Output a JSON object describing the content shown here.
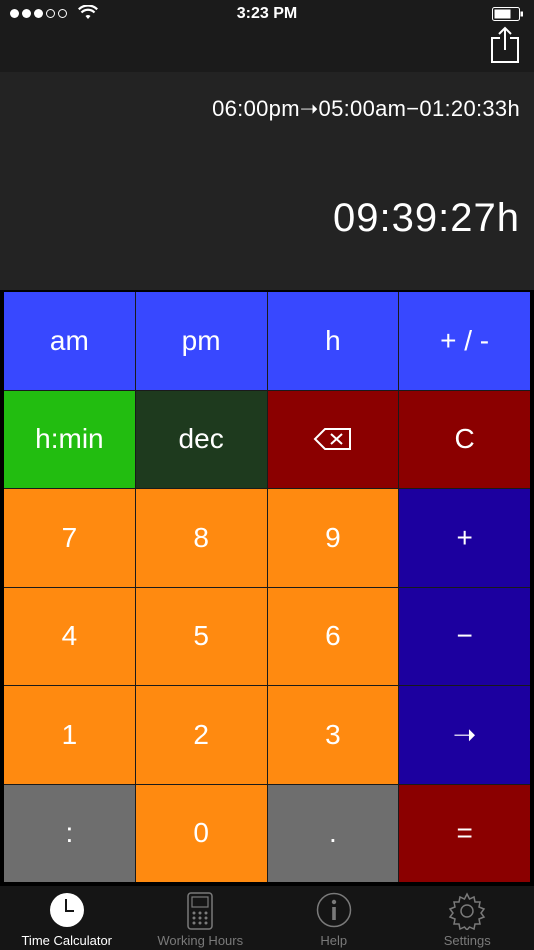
{
  "status_bar": {
    "time": "3:23 PM"
  },
  "display": {
    "expression": "06:00pm➝05:00am−01:20:33h",
    "result": "09:39:27h"
  },
  "keypad": {
    "rows": [
      [
        "am",
        "pm",
        "h",
        "+ / -"
      ],
      [
        "h:min",
        "dec",
        "⌫",
        "C"
      ],
      [
        "7",
        "8",
        "9",
        "+"
      ],
      [
        "4",
        "5",
        "6",
        "−"
      ],
      [
        "1",
        "2",
        "3",
        "➝"
      ],
      [
        ":",
        "0",
        ".",
        "="
      ]
    ]
  },
  "tabs": [
    {
      "label": "Time Calculator",
      "icon": "clock-icon"
    },
    {
      "label": "Working Hours",
      "icon": "time-clock-icon"
    },
    {
      "label": "Help",
      "icon": "info-icon"
    },
    {
      "label": "Settings",
      "icon": "gear-icon"
    }
  ],
  "colors": {
    "blue": "#3848ff",
    "green": "#22bd10",
    "dark_green": "#1e3a1e",
    "red": "#8b0000",
    "orange": "#ff8a10",
    "navy": "#1c009f",
    "gray": "#6e6e6e"
  }
}
